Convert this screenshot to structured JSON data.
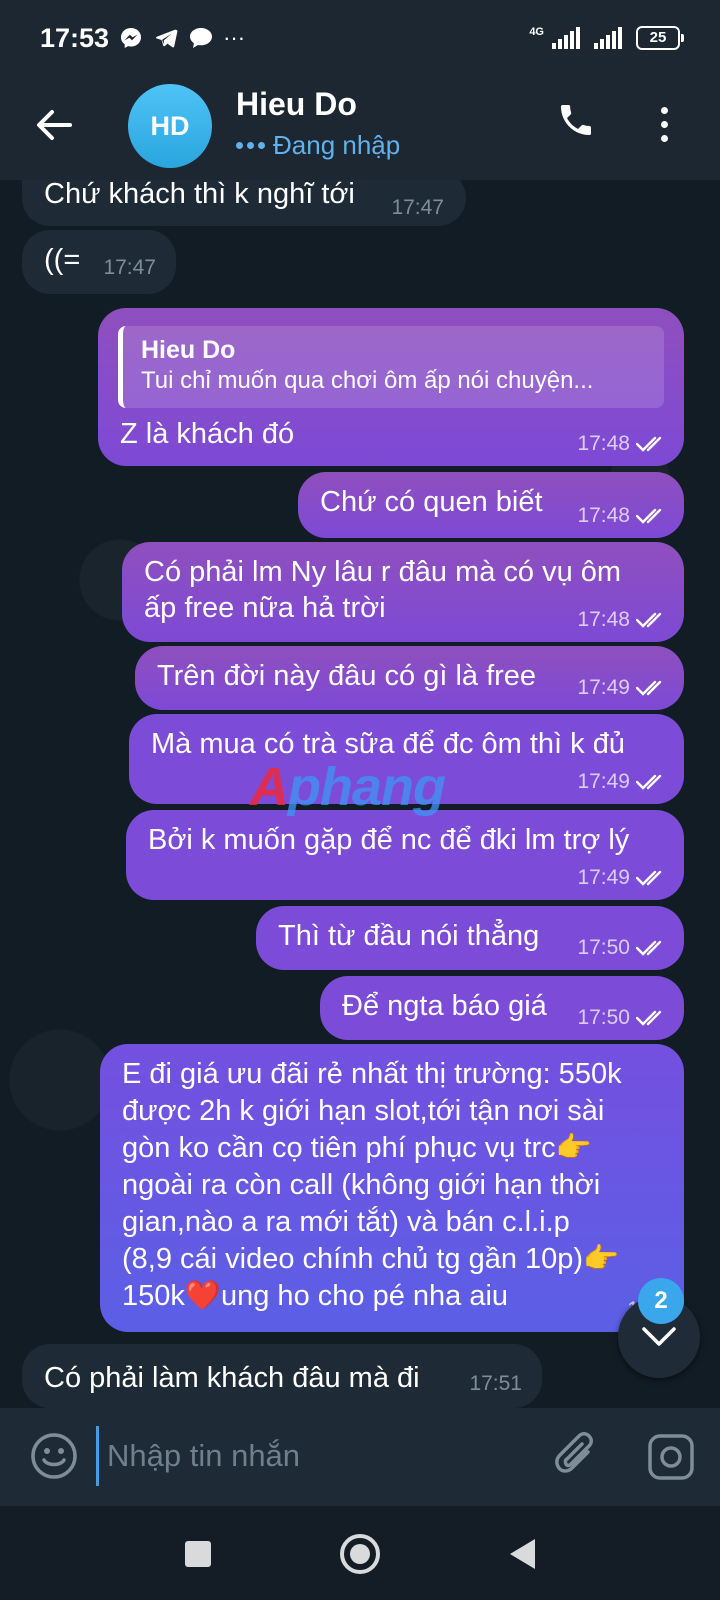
{
  "status_bar": {
    "time": "17:53",
    "network_label": "4G",
    "battery": "25",
    "more": "···"
  },
  "header": {
    "avatar_initials": "HD",
    "contact_name": "Hieu Do",
    "contact_status": "Đang nhập"
  },
  "messages": [
    {
      "dir": "in",
      "text": "Chứ khách thì k nghĩ tới",
      "time": "17:47"
    },
    {
      "dir": "in",
      "text": "((=",
      "time": "17:47"
    },
    {
      "dir": "out",
      "reply_to": {
        "name": "Hieu Do",
        "text": "Tui chỉ muốn qua chơi ôm ấp nói chuyện..."
      },
      "text": "Z là khách đó",
      "time": "17:48"
    },
    {
      "dir": "out",
      "text": "Chứ có quen biết",
      "time": "17:48"
    },
    {
      "dir": "out",
      "line1": "Có phải lm Ny lâu r đâu mà có vụ ôm",
      "line2": "ấp free nữa hả trời",
      "time": "17:48"
    },
    {
      "dir": "out",
      "text": "Trên đời này đâu có gì là free",
      "time": "17:49"
    },
    {
      "dir": "out",
      "text": "Mà mua có trà sữa để đc ôm thì k đủ",
      "time": "17:49"
    },
    {
      "dir": "out",
      "text": "Bởi k muốn gặp để nc để đki lm trợ lý",
      "time": "17:49"
    },
    {
      "dir": "out",
      "text": "Thì từ đầu nói thẳng",
      "time": "17:50"
    },
    {
      "dir": "out",
      "text": "Để ngta báo giá",
      "time": "17:50"
    },
    {
      "dir": "out",
      "lines": [
        "E đi giá ưu đãi rẻ nhất thị trường: 550k",
        "được 2h k giới hạn slot,tới tận nơi sài",
        "gòn ko cần cọ tiên phí phục vụ trc👉",
        "ngoài ra còn call (không giới hạn thời",
        "gian,nào a ra mới tắt) và bán c.l.i.p",
        "(8,9 cái video chính chủ tg gần 10p)👉",
        "150k❤️ung ho cho pé nha aiu"
      ],
      "time": "17:5"
    },
    {
      "dir": "in",
      "text": "Có phải làm khách đâu mà đi",
      "time": "17:51"
    }
  ],
  "watermark": {
    "a": "A",
    "rest": "phang"
  },
  "scroll_down": {
    "unread_count": "2"
  },
  "composer": {
    "placeholder": "Nhập tin nhắn"
  },
  "colors": {
    "accent": "#3aa7ec",
    "bubble_out": "#7d4ad6",
    "bubble_in": "#1e2b36",
    "background": "#111c25"
  },
  "icons": [
    "back-arrow-icon",
    "phone-icon",
    "more-vertical-icon",
    "double-check-icon",
    "chevron-down-icon",
    "emoji-icon",
    "paperclip-icon",
    "camera-icon",
    "nav-square-icon",
    "nav-circle-icon",
    "nav-back-triangle-icon"
  ]
}
